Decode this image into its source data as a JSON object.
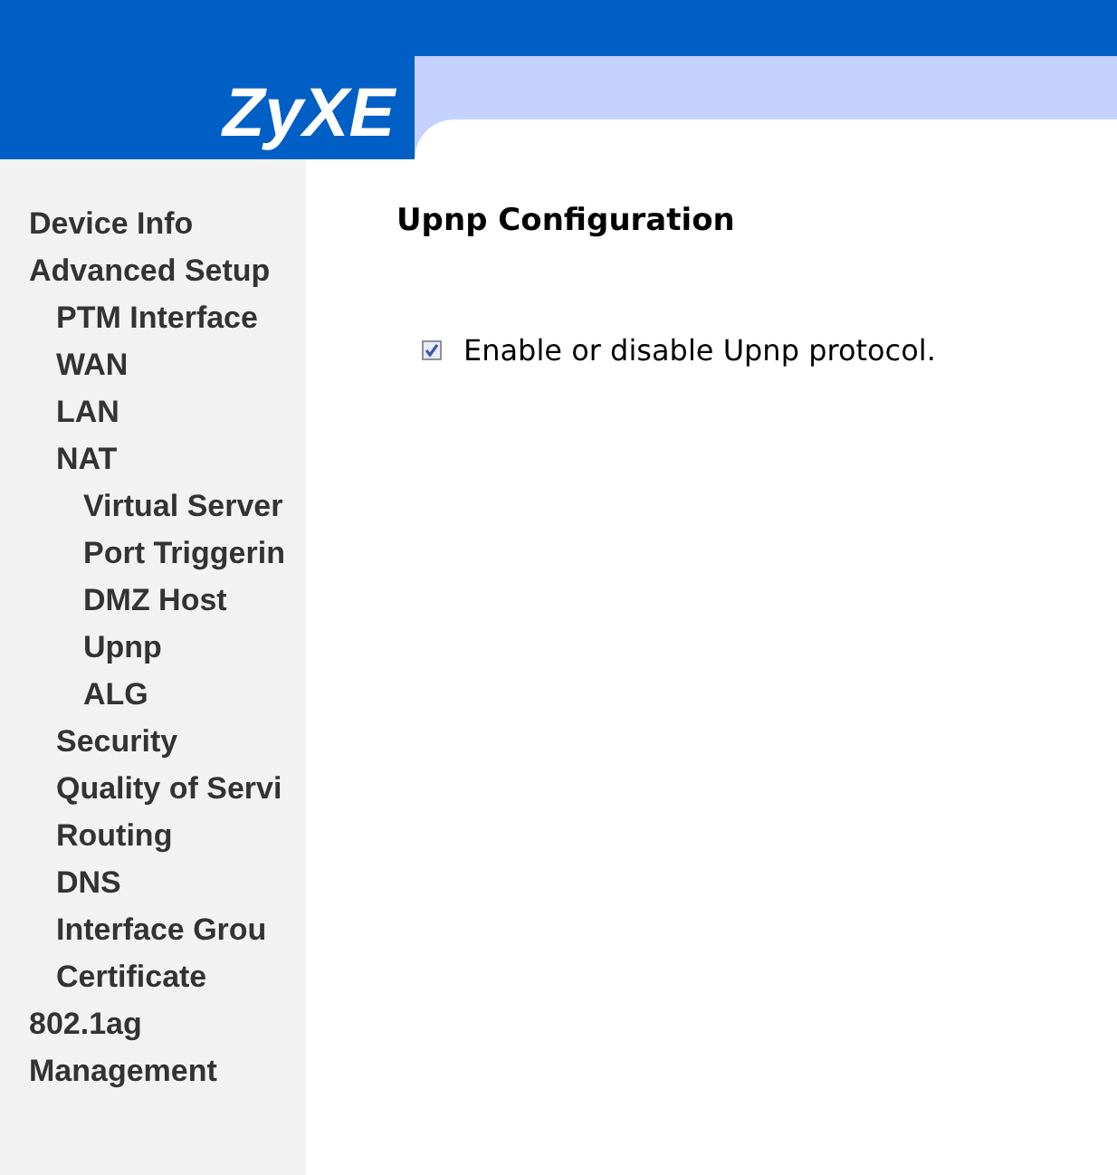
{
  "logo": {
    "text": "ZyXE"
  },
  "sidebar": {
    "items": [
      {
        "label": "Device Info"
      },
      {
        "label": "Advanced Setup",
        "children": [
          {
            "label": "PTM Interface"
          },
          {
            "label": "WAN"
          },
          {
            "label": "LAN"
          },
          {
            "label": "NAT",
            "children": [
              {
                "label": "Virtual Server"
              },
              {
                "label": "Port Triggerin"
              },
              {
                "label": "DMZ Host"
              },
              {
                "label": "Upnp"
              },
              {
                "label": "ALG"
              }
            ]
          },
          {
            "label": "Security"
          },
          {
            "label": "Quality of Servi"
          },
          {
            "label": "Routing"
          },
          {
            "label": "DNS"
          },
          {
            "label": "Interface Grou"
          },
          {
            "label": "Certificate"
          }
        ]
      },
      {
        "label": "802.1ag"
      },
      {
        "label": "Management"
      }
    ]
  },
  "content": {
    "title": "Upnp Configuration",
    "option": {
      "label": "Enable or disable Upnp protocol.",
      "checked": true
    }
  }
}
